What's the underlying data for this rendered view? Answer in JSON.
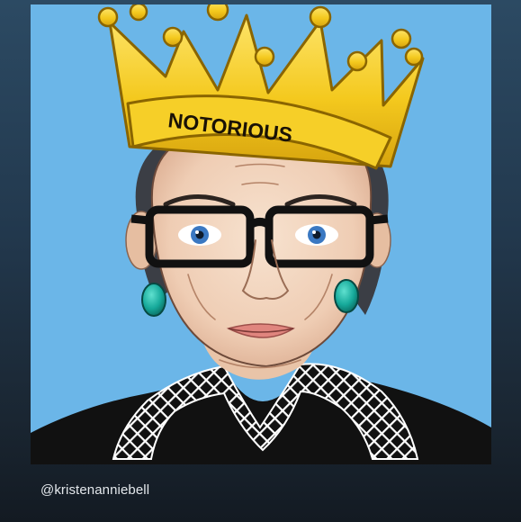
{
  "artwork": {
    "crown_label": "NOTORIOUS",
    "background_color": "#6bb6e8",
    "crown_color": "#f4c91e",
    "earring_color": "#16a99a",
    "robe_color": "#111111",
    "collar_color": "#ffffff"
  },
  "caption": {
    "credit": "@kristenanniebell"
  }
}
